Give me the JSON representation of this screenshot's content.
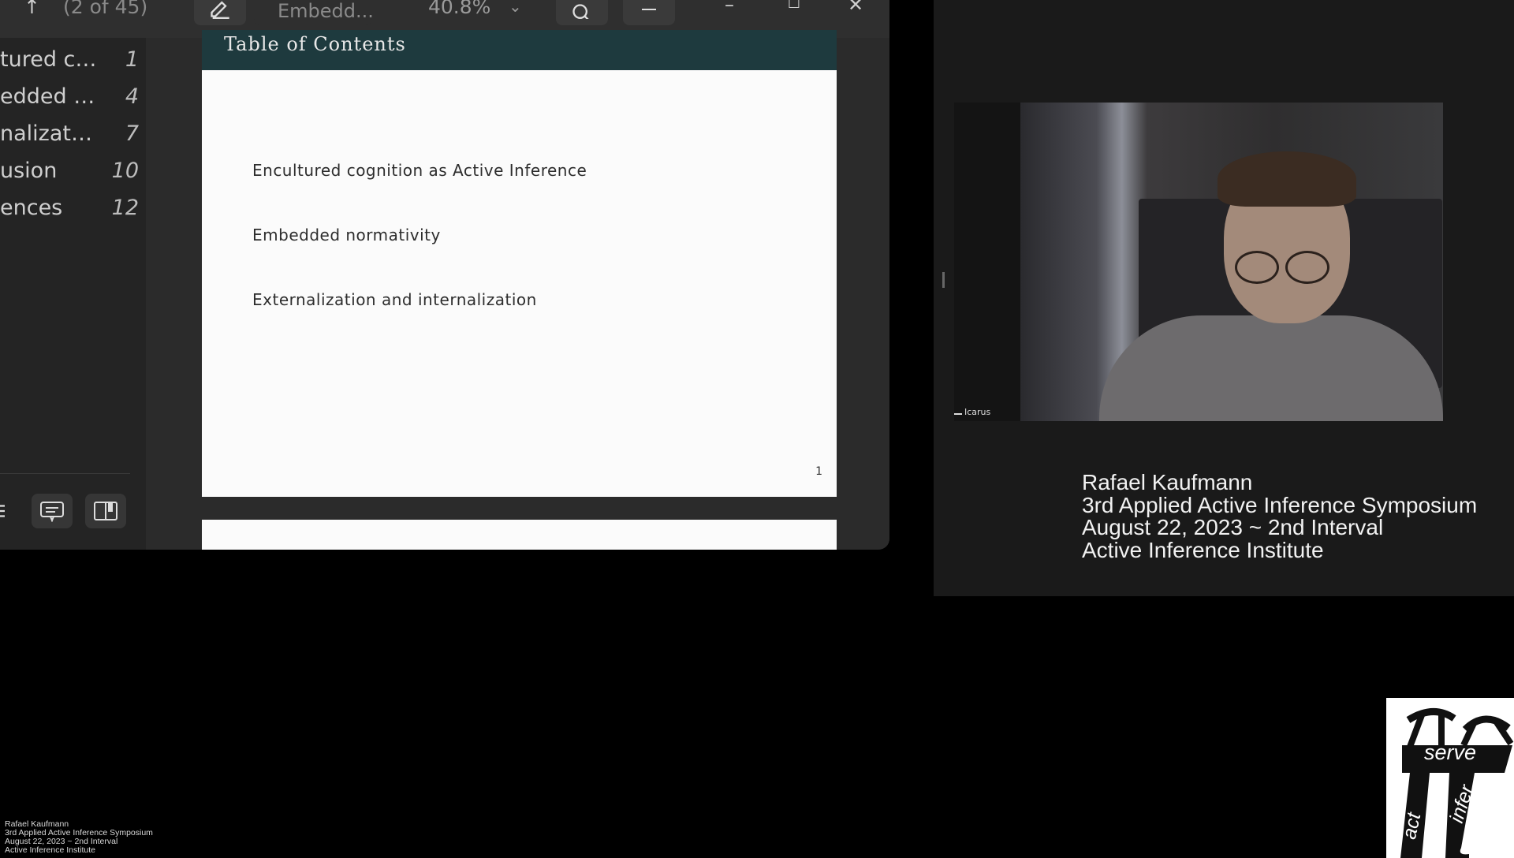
{
  "viewer": {
    "toolbar": {
      "page_count": "(2 of 45)",
      "doc_title": "Embedd...",
      "zoom": "40.8%",
      "icons": [
        "edit-icon",
        "chevron-down-icon",
        "search-icon",
        "menu-icon",
        "minimize-icon",
        "maximize-icon",
        "close-icon"
      ]
    },
    "sidebar": {
      "items": [
        {
          "label": "tured c…",
          "page": "1"
        },
        {
          "label": "edded …",
          "page": "4"
        },
        {
          "label": "nalizat…",
          "page": "7"
        },
        {
          "label": "usion",
          "page": "10"
        },
        {
          "label": "ences",
          "page": "12"
        }
      ]
    },
    "slide": {
      "header": "Table of Contents",
      "items": [
        "Encultured cognition as Active Inference",
        "Embedded normativity",
        "Externalization and internalization"
      ],
      "page_number": "1"
    }
  },
  "video": {
    "participant_name": "Icarus"
  },
  "caption": {
    "line1": "Rafael Kaufmann",
    "line2": "3rd Applied Active Inference Symposium",
    "line3": "August 22, 2023 ~ 2nd Interval",
    "line4": "Active Inference Institute"
  },
  "logo": {
    "word1": "serve",
    "word2": "act",
    "word3": "infer"
  }
}
